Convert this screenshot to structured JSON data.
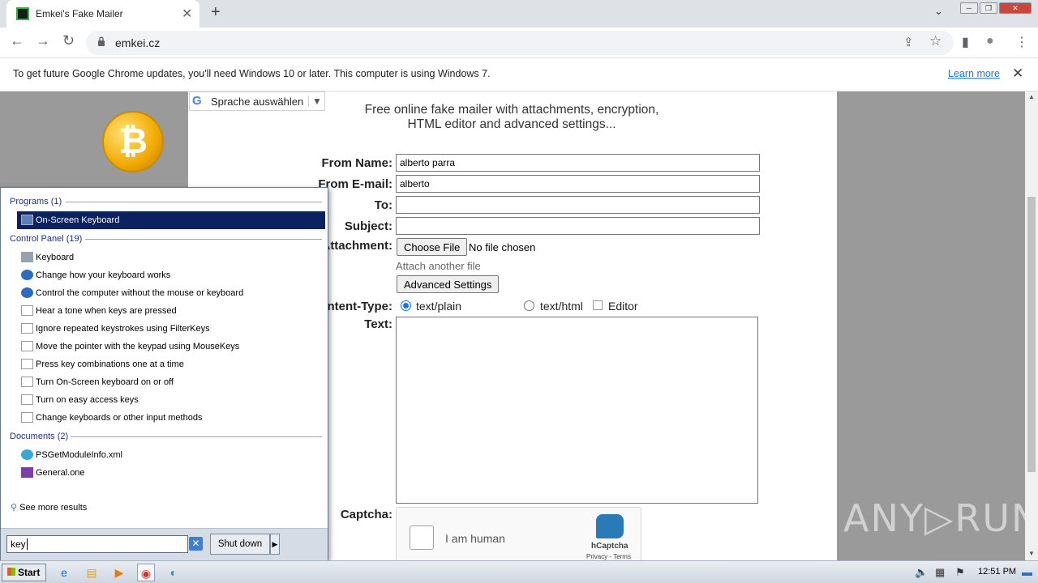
{
  "browser": {
    "tab_title": "Emkei's Fake Mailer",
    "tab_close": "✕",
    "new_tab": "+",
    "tab_search": "⌄",
    "window_min": "─",
    "window_restore": "❐",
    "window_close": "✕",
    "url": "emkei.cz",
    "back": "←",
    "forward": "→",
    "reload": "↻",
    "share": "⇪",
    "star": "☆",
    "sidepanel": "▮",
    "profile": "●",
    "menu": "⋮"
  },
  "infobar": {
    "text": "To get future Google Chrome updates, you'll need Windows 10 or later. This computer is using Windows 7.",
    "link": "Learn more",
    "close": "✕"
  },
  "page": {
    "translate_label": "Sprache auswählen",
    "translate_g": "G",
    "translate_arrow": "▼",
    "headline_line1": "Free online fake mailer with attachments, encryption,",
    "headline_line2": "HTML editor and advanced settings...",
    "bitcoin_symbol": "₿",
    "form": {
      "from_name_label": "From Name:",
      "from_name_value": "alberto parra",
      "from_email_label": "From E-mail:",
      "from_email_value": "alberto",
      "to_label": "To:",
      "to_value": "",
      "subject_label": "Subject:",
      "subject_value": "",
      "attachment_label": "Attachment:",
      "choose_file": "Choose File",
      "no_file": "No file chosen",
      "attach_another": "Attach another file",
      "advanced_settings": "Advanced Settings",
      "content_type_label": "Content-Type:",
      "opt_plain": "text/plain",
      "opt_html": "text/html",
      "opt_editor": "Editor",
      "text_label": "Text:",
      "captcha_label": "Captcha:",
      "captcha_text": "I am human",
      "captcha_brand": "hCaptcha",
      "captcha_links": "Privacy - Terms"
    },
    "watermark": "ANY▷RUN"
  },
  "start_menu": {
    "programs_header": "Programs (1)",
    "programs": [
      "On-Screen Keyboard"
    ],
    "control_panel_header": "Control Panel (19)",
    "control_panel": [
      "Keyboard",
      "Change how your keyboard works",
      "Control the computer without the mouse or keyboard",
      "Hear a tone when keys are pressed",
      "Ignore repeated keystrokes using FilterKeys",
      "Move the pointer with the keypad using MouseKeys",
      "Press key combinations one at a time",
      "Turn On-Screen keyboard on or off",
      "Turn on easy access keys",
      "Change keyboards or other input methods"
    ],
    "documents_header": "Documents (2)",
    "documents": [
      "PSGetModuleInfo.xml",
      "General.one"
    ],
    "see_more": "See more results",
    "search_value": "key",
    "clear": "✕",
    "shutdown": "Shut down",
    "shutdown_arrow": "▶"
  },
  "taskbar": {
    "start": "Start",
    "clock": "12:51 PM"
  }
}
